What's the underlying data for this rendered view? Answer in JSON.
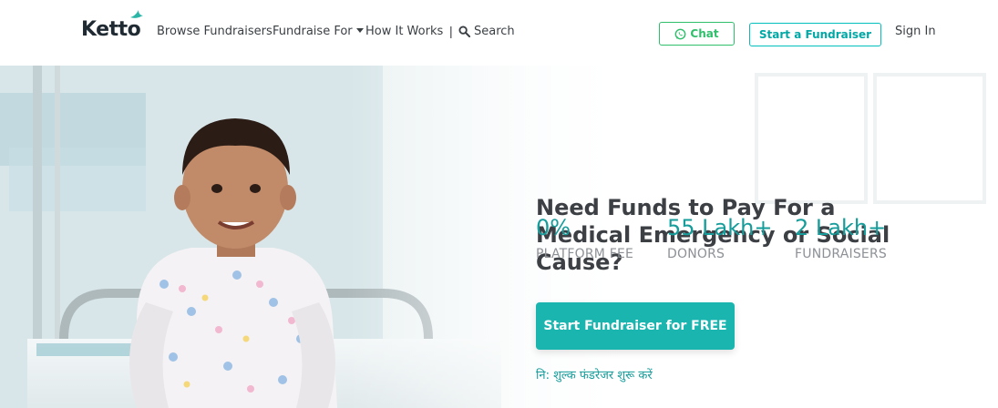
{
  "header": {
    "logo_text": "Ketto",
    "nav": {
      "browse": "Browse Fundraisers",
      "fundraise_for": "Fundraise For",
      "how_it_works": "How It Works",
      "separator": "|"
    },
    "search_label": "Search",
    "chat_label": "Chat",
    "start_label": "Start a Fundraiser",
    "signin_label": "Sign In"
  },
  "hero": {
    "headline": "Need Funds to Pay For a Medical Emergency or Social Cause?",
    "stats": [
      {
        "value": "0%",
        "label": "PLATFORM FEE"
      },
      {
        "value": "55 Lakh+",
        "label": "DONORS"
      },
      {
        "value": "2 Lakh+",
        "label": "FUNDRAISERS"
      }
    ],
    "cta_label": "Start Fundraiser for FREE",
    "hindi_text": "नि: शुल्क फंडरेजर शुरू करें"
  },
  "colors": {
    "brand_teal": "#1bb5b0",
    "stat_teal": "#169c9a",
    "chat_green": "#2fbf6b",
    "headline": "#3c3f44"
  },
  "icons": [
    "ketto-bird-icon",
    "caret-down-icon",
    "search-icon",
    "whatsapp-icon"
  ]
}
